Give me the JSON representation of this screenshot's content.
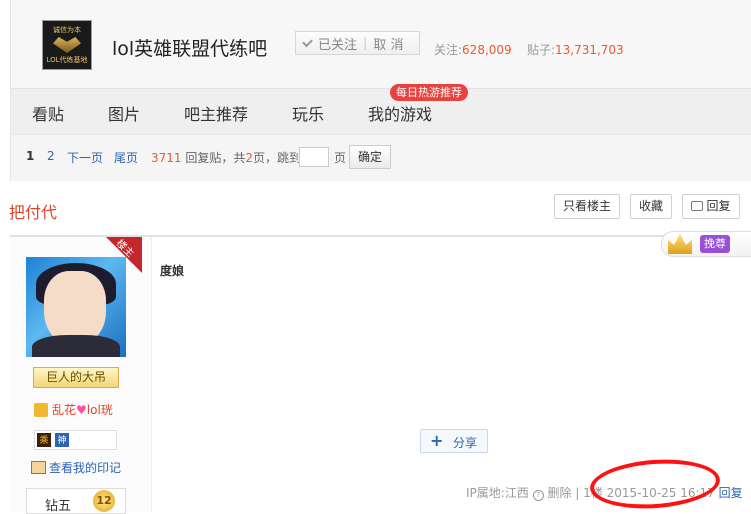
{
  "header": {
    "logo_top": "诚信为本",
    "logo_bottom": "LOL代练基地",
    "forum_name": "lol英雄联盟代练吧",
    "follow_label": "已关注",
    "unfollow_label": "取 消",
    "stats_follow_label": "关注:",
    "stats_follow_value": "628,009",
    "stats_posts_label": "贴子:",
    "stats_posts_value": "13,731,703"
  },
  "nav": {
    "items": [
      "看贴",
      "图片",
      "吧主推荐",
      "玩乐",
      "我的游戏"
    ],
    "hot_badge": "每日热游推荐"
  },
  "pager": {
    "page1": "1",
    "page2": "2",
    "next": "下一页",
    "last": "尾页",
    "reply_count": "3711",
    "reply_text": "回复贴，共",
    "total_pages": "2",
    "page_suffix": "页，跳到",
    "ye": "页",
    "confirm": "确定"
  },
  "thread": {
    "title": "把付代",
    "only_op": "只看楼主",
    "favorite": "收藏",
    "reply": "回复"
  },
  "post": {
    "corner_label": "楼主",
    "level_title": "巨人的大吊",
    "fan_name_a": "乱花",
    "fan_name_b": "lol珖",
    "badge1": "乘",
    "badge2": "神",
    "seal_link": "查看我的印记",
    "rank_name": "钻五",
    "rank_num": "12",
    "vip_label": "挽尊",
    "content": "度娘",
    "share_label": "分享",
    "ip_location": "IP属地:江西",
    "q_icon": "?",
    "delete": "删除",
    "separator": "| 1楼",
    "datetime": "2015-10-25 16:17",
    "reply": "回复"
  },
  "colors": {
    "accent_red": "#e0442b",
    "link_blue": "#2d64b3",
    "hot_badge": "#e8423f"
  }
}
